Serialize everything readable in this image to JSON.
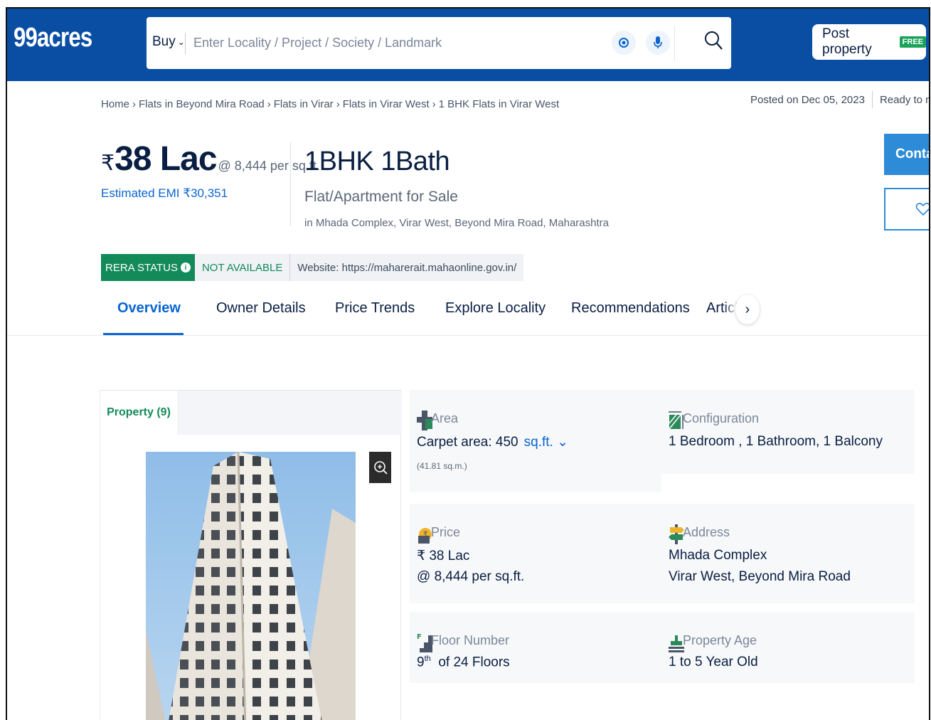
{
  "header": {
    "logo": "99acres",
    "buy_label": "Buy",
    "search_placeholder": "Enter Locality / Project / Society / Landmark",
    "post_property_label": "Post property",
    "free_badge": "FREE",
    "brand_color": "#0a4ea3"
  },
  "breadcrumb": {
    "items": [
      "Home",
      "Flats in Beyond Mira Road",
      "Flats in Virar",
      "Flats in Virar West",
      "1 BHK Flats in Virar West"
    ],
    "separator": "›"
  },
  "posting": {
    "posted_on": "Posted on Dec 05, 2023",
    "status": "Ready to move"
  },
  "listing": {
    "currency_symbol": "₹",
    "price": "38 Lac",
    "per_sqft": "@ 8,444 per sq.ft.",
    "emi": "Estimated EMI ₹30,351",
    "title": "1BHK 1Bath",
    "type": "Flat/Apartment for Sale",
    "location": "in Mhada Complex, Virar West, Beyond Mira Road, Maharashtra"
  },
  "actions": {
    "contact_label": "Contac"
  },
  "rera": {
    "status_label": "RERA STATUS",
    "availability": "NOT AVAILABLE",
    "website": "Website: https://maharerait.mahaonline.gov.in/"
  },
  "tabs": {
    "items": [
      "Overview",
      "Owner Details",
      "Price Trends",
      "Explore Locality",
      "Recommendations",
      "Articl"
    ],
    "active": "Overview"
  },
  "gallery": {
    "tab_label": "Property (9)"
  },
  "details": {
    "area": {
      "label": "Area",
      "value": "Carpet area: 450",
      "unit": "sq.ft.",
      "sub": "(41.81 sq.m.)"
    },
    "configuration": {
      "label": "Configuration",
      "value": "1 Bedroom , 1 Bathroom, 1 Balcony"
    },
    "price": {
      "label": "Price",
      "value": "₹ 38 Lac",
      "sub": "@ 8,444 per sq.ft."
    },
    "address": {
      "label": "Address",
      "line1": "Mhada Complex",
      "line2": "Virar West, Beyond Mira Road"
    },
    "floor": {
      "label": "Floor Number",
      "floor": "9",
      "suffix": "th",
      "total": "of 24 Floors"
    },
    "age": {
      "label": "Property Age",
      "value": "1 to 5 Year Old"
    }
  }
}
